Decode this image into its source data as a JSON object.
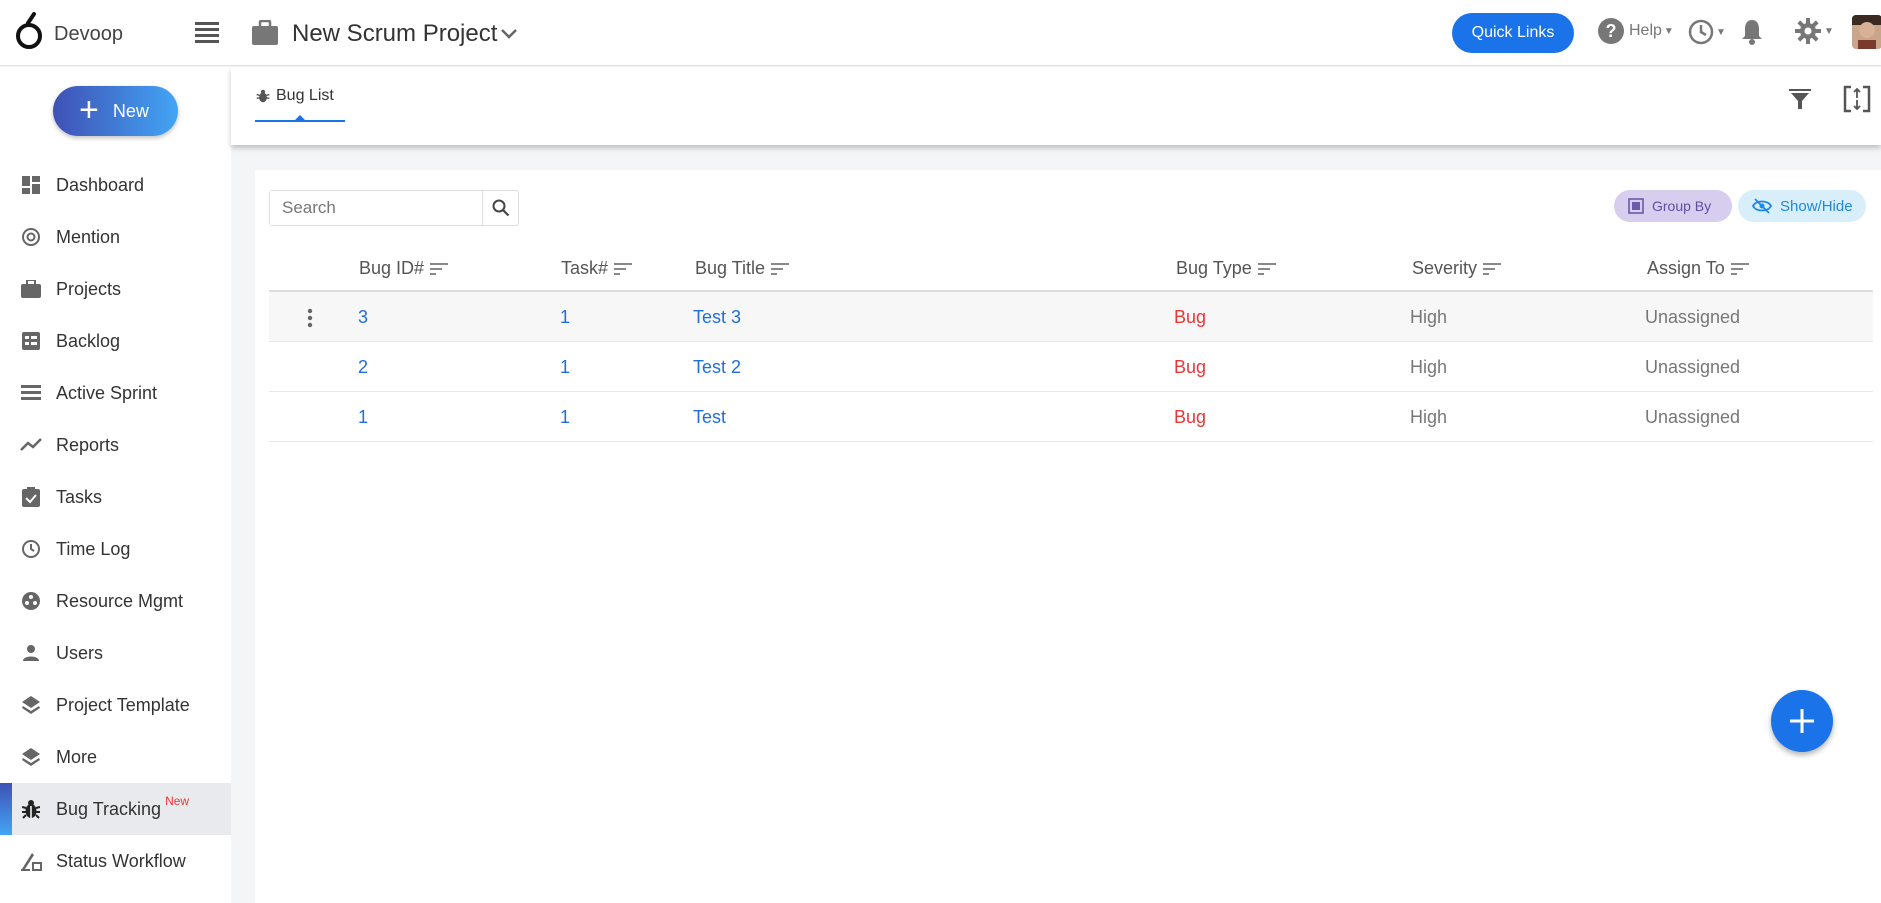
{
  "app": {
    "name": "Devoop"
  },
  "header": {
    "project_title": "New Scrum Project",
    "quick_links": "Quick Links",
    "help": "Help"
  },
  "sidebar": {
    "new_label": "New",
    "items": [
      {
        "label": "Dashboard",
        "icon": "dashboard-icon"
      },
      {
        "label": "Mention",
        "icon": "at-icon"
      },
      {
        "label": "Projects",
        "icon": "briefcase-icon"
      },
      {
        "label": "Backlog",
        "icon": "backlog-icon"
      },
      {
        "label": "Active Sprint",
        "icon": "sprint-icon"
      },
      {
        "label": "Reports",
        "icon": "trend-icon"
      },
      {
        "label": "Tasks",
        "icon": "clipboard-check-icon"
      },
      {
        "label": "Time Log",
        "icon": "clock-icon"
      },
      {
        "label": "Resource Mgmt",
        "icon": "resource-icon"
      },
      {
        "label": "Users",
        "icon": "user-icon"
      },
      {
        "label": "Project Template",
        "icon": "layers-icon"
      },
      {
        "label": "More",
        "icon": "layers-icon"
      },
      {
        "label": "Bug Tracking",
        "icon": "bug-icon",
        "badge": "New",
        "active": true
      },
      {
        "label": "Status Workflow",
        "icon": "workflow-icon"
      }
    ]
  },
  "tabs": {
    "bug_list": "Bug List"
  },
  "toolbar": {
    "search_placeholder": "Search",
    "group_by": "Group By",
    "show_hide": "Show/Hide"
  },
  "table": {
    "columns": [
      "Bug ID#",
      "Task#",
      "Bug Title",
      "Bug Type",
      "Severity",
      "Assign To"
    ],
    "rows": [
      {
        "bug_id": "3",
        "task": "1",
        "title": "Test 3",
        "type": "Bug",
        "severity": "High",
        "assign": "Unassigned"
      },
      {
        "bug_id": "2",
        "task": "1",
        "title": "Test 2",
        "type": "Bug",
        "severity": "High",
        "assign": "Unassigned"
      },
      {
        "bug_id": "1",
        "task": "1",
        "title": "Test",
        "type": "Bug",
        "severity": "High",
        "assign": "Unassigned"
      }
    ]
  },
  "colors": {
    "primary": "#1a73e8",
    "bug_red": "#e53935",
    "link": "#1e6fd9"
  }
}
